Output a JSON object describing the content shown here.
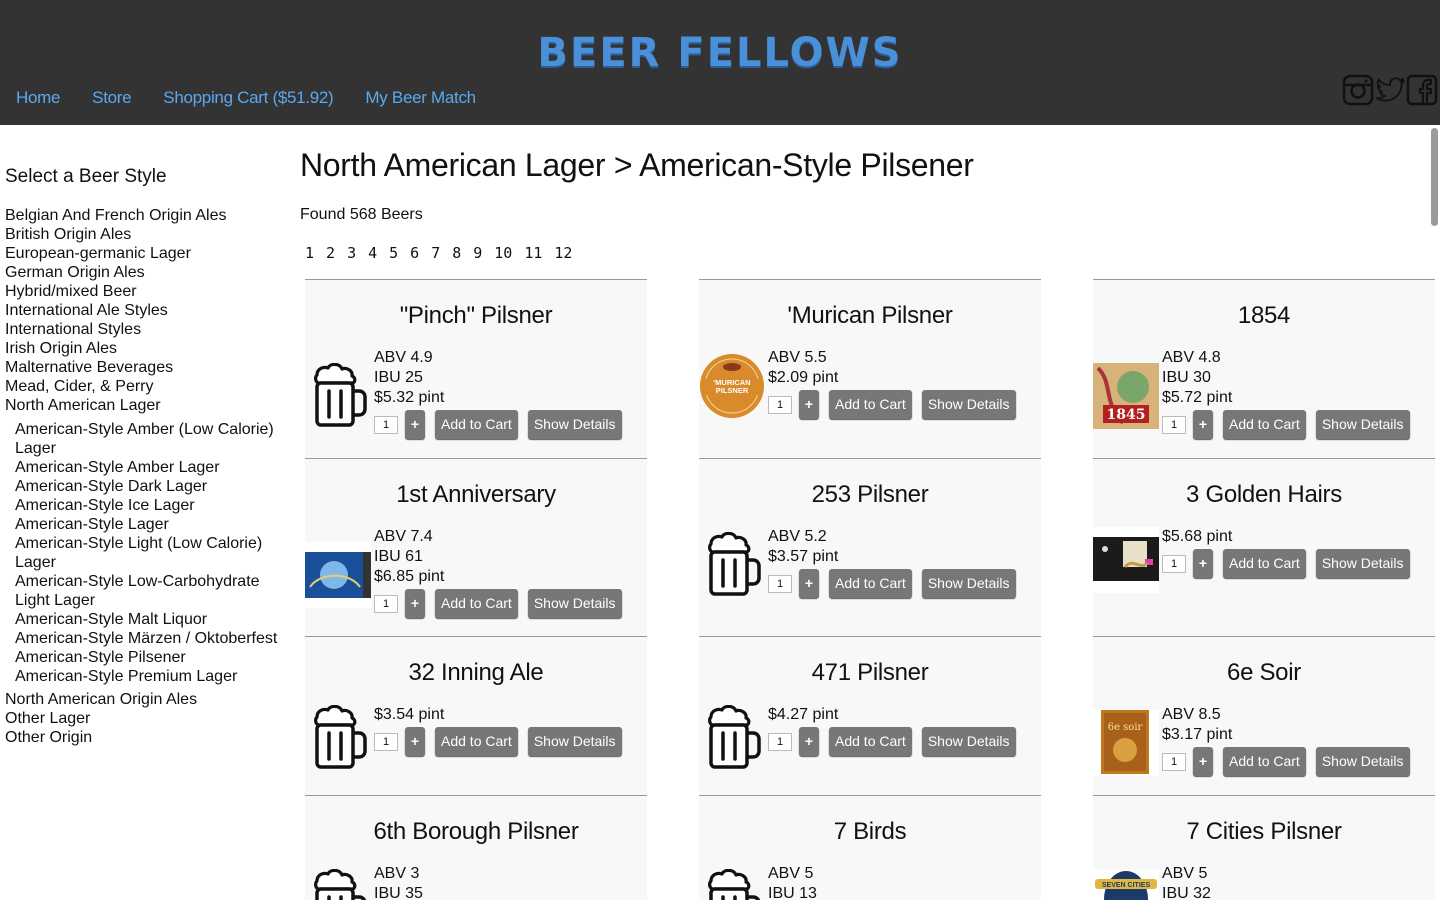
{
  "header": {
    "logo": "BEER FELLOWS",
    "nav": [
      "Home",
      "Store",
      "Shopping Cart ($51.92)",
      "My Beer Match"
    ],
    "social_icons": [
      "instagram-icon",
      "twitter-icon",
      "facebook-icon"
    ]
  },
  "sidebar": {
    "title": "Select a Beer Style",
    "categories_top": [
      "Belgian And French Origin Ales",
      "British Origin Ales",
      "European-germanic Lager",
      "German Origin Ales",
      "Hybrid/mixed Beer",
      "International Ale Styles",
      "International Styles",
      "Irish Origin Ales",
      "Malternative Beverages",
      "Mead, Cider, & Perry",
      "North American Lager"
    ],
    "subcategories": [
      "American-Style Amber (Low Calorie) Lager",
      "American-Style Amber Lager",
      "American-Style Dark Lager",
      "American-Style Ice Lager",
      "American-Style Lager",
      "American-Style Light (Low Calorie) Lager",
      "American-Style Low-Carbohydrate Light Lager",
      "American-Style Malt Liquor",
      "American-Style Märzen / Oktoberfest",
      "American-Style Pilsener",
      "American-Style Premium Lager"
    ],
    "categories_bottom": [
      "North American Origin Ales",
      "Other Lager",
      "Other Origin"
    ]
  },
  "main": {
    "title": "North American Lager > American-Style Pilsener",
    "found": "Found 568 Beers",
    "pages": [
      "1",
      "2",
      "3",
      "4",
      "5",
      "6",
      "7",
      "8",
      "9",
      "10",
      "11",
      "12"
    ]
  },
  "buttons": {
    "plus": "+",
    "add": "Add to Cart",
    "details": "Show Details",
    "qty": "1"
  },
  "beers": [
    {
      "name": "\"Pinch\" Pilsner",
      "lines": [
        "ABV 4.9",
        "IBU 25",
        "$5.32 pint"
      ],
      "image": "beer-mug-icon"
    },
    {
      "name": "'Murican Pilsner",
      "lines": [
        "ABV 5.5",
        "$2.09 pint"
      ],
      "image": "murican-label",
      "label_text": "'MURICAN PILSNER"
    },
    {
      "name": "1854",
      "lines": [
        "ABV 4.8",
        "IBU 30",
        "$5.72 pint"
      ],
      "image": "1854-label",
      "label_text": "1845"
    },
    {
      "name": "1st Anniversary",
      "lines": [
        "ABV 7.4",
        "IBU 61",
        "$6.85 pint"
      ],
      "image": "anniversary-label"
    },
    {
      "name": "253 Pilsner",
      "lines": [
        "ABV 5.2",
        "$3.57 pint"
      ],
      "image": "beer-mug-icon"
    },
    {
      "name": "3 Golden Hairs",
      "lines": [
        "$5.68 pint"
      ],
      "image": "golden-hairs-label"
    },
    {
      "name": "32 Inning Ale",
      "lines": [
        "$3.54 pint"
      ],
      "image": "beer-mug-icon"
    },
    {
      "name": "471 Pilsner",
      "lines": [
        "$4.27 pint"
      ],
      "image": "beer-mug-icon"
    },
    {
      "name": "6e Soir",
      "lines": [
        "ABV 8.5",
        "$3.17 pint"
      ],
      "image": "6e-soir-label",
      "label_text": "6e soir"
    },
    {
      "name": "6th Borough Pilsner",
      "lines": [
        "ABV 3",
        "IBU 35"
      ],
      "image": "beer-mug-icon"
    },
    {
      "name": "7 Birds",
      "lines": [
        "ABV 5",
        "IBU 13"
      ],
      "image": "beer-mug-icon"
    },
    {
      "name": "7 Cities Pilsner",
      "lines": [
        "ABV 5",
        "IBU 32"
      ],
      "image": "seven-cities-label",
      "label_text": "SEVEN CITIES"
    }
  ],
  "colors": {
    "header_bg": "#333333",
    "nav_link": "#5aa9f0",
    "logo": "#4a90d9",
    "button": "#777777",
    "card_bg": "#f8f8f8"
  }
}
